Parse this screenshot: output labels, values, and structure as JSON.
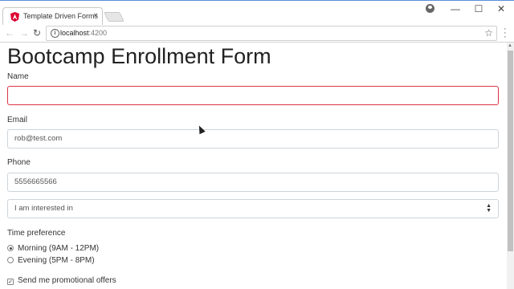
{
  "browser": {
    "tab_title": "Template Driven Forms",
    "close_glyph": "×",
    "url_host": "localhost",
    "url_port": ":4200",
    "window_controls": [
      "—",
      "☐",
      "✕"
    ]
  },
  "form": {
    "title": "Bootcamp Enrollment Form",
    "name": {
      "label": "Name",
      "value": ""
    },
    "email": {
      "label": "Email",
      "value": "rob@test.com"
    },
    "phone": {
      "label": "Phone",
      "value": "5556665566"
    },
    "interest": {
      "selected": "I am interested in"
    },
    "time_preference": {
      "label": "Time preference",
      "options": [
        {
          "label": "Morning (9AM - 12PM)",
          "checked": true
        },
        {
          "label": "Evening (5PM - 8PM)",
          "checked": false
        }
      ]
    },
    "promo": {
      "label": "Send me promotional offers",
      "checked": true
    }
  },
  "colors": {
    "accent": "#5b8ed6",
    "invalid_border": "#dc3545",
    "angular_red": "#dd0031"
  }
}
